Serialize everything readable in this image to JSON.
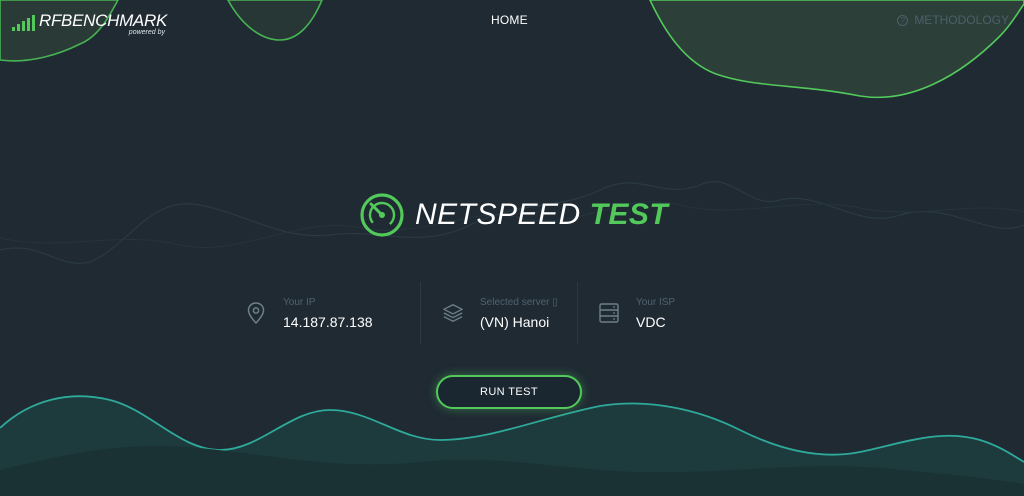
{
  "header": {
    "logo_name": "RFBENCHMARK",
    "logo_sub": "powered by",
    "nav_home": "HOME",
    "nav_methodology": "METHODOLOGY",
    "methodology_icon": "?"
  },
  "hero": {
    "title_part1": "NETSPEED",
    "title_part2": "TEST"
  },
  "info": {
    "ip": {
      "label": "Your IP",
      "value": "14.187.87.138",
      "icon": "location-pin-icon"
    },
    "server": {
      "label": "Selected server",
      "label_icon": "▯",
      "value": "(VN) Hanoi",
      "icon": "layers-icon"
    },
    "isp": {
      "label": "Your ISP",
      "value": "VDC",
      "icon": "server-icon"
    }
  },
  "actions": {
    "run_test": "RUN TEST"
  },
  "colors": {
    "accent": "#52c95a",
    "teal": "#2ea99a",
    "background": "#1f2a33"
  }
}
